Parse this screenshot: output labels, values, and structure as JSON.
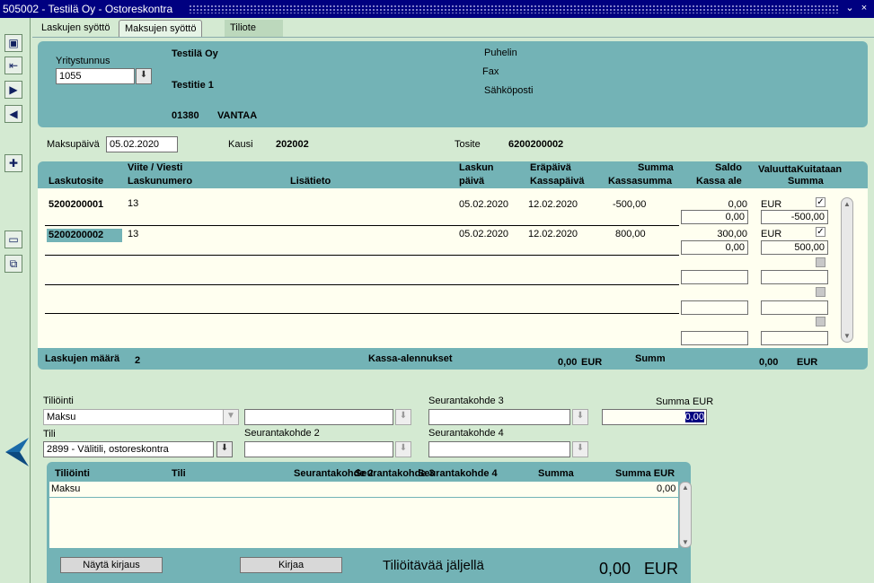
{
  "window": {
    "title": "505002 - Testilä Oy - Ostoreskontra",
    "minimize": "⌄",
    "close": "×"
  },
  "tabs": [
    {
      "label": "Laskujen syöttö"
    },
    {
      "label": "Maksujen syöttö"
    },
    {
      "label": "Tiliote"
    }
  ],
  "company": {
    "yritystunnus_label": "Yritystunnus",
    "yritystunnus_value": "1055",
    "name": "Testilä Oy",
    "address": "Testitie 1",
    "postal_code": "01380",
    "city": "VANTAA",
    "phone_label": "Puhelin",
    "fax_label": "Fax",
    "email_label": "Sähköposti"
  },
  "payment": {
    "maksupaiva_label": "Maksupäivä",
    "maksupaiva_value": "05.02.2020",
    "kausi_label": "Kausi",
    "kausi_value": "202002",
    "tosite_label": "Tosite",
    "tosite_value": "6200200002"
  },
  "grid": {
    "headers": {
      "laskutosite": "Laskutosite",
      "viite": "Viite / Viesti",
      "laskunumero": "Laskunumero",
      "lisatieto": "Lisätieto",
      "laskun": "Laskun",
      "paiva": "päivä",
      "erapaiva": "Eräpäivä",
      "kassapaiva": "Kassapäivä",
      "summa": "Summa",
      "kassasumma": "Kassasumma",
      "saldo": "Saldo",
      "kassa_ale": "Kassa ale",
      "valuutta": "Valuutta",
      "kuitataan": "Kuitataan",
      "summa2": "Summa"
    },
    "rows": [
      {
        "laskutosite": "5200200001",
        "viite": "13",
        "laskun_paiva": "05.02.2020",
        "erapaiva": "12.02.2020",
        "summa": "-500,00",
        "saldo": "0,00",
        "kassa_ale": "0,00",
        "valuutta": "EUR",
        "kuitataan": true,
        "kuitataan_summa": "-500,00"
      },
      {
        "laskutosite": "5200200002",
        "viite": "13",
        "laskun_paiva": "05.02.2020",
        "erapaiva": "12.02.2020",
        "summa": "800,00",
        "saldo": "300,00",
        "kassa_ale": "0,00",
        "valuutta": "EUR",
        "kuitataan": true,
        "kuitataan_summa": "500,00"
      }
    ],
    "footer": {
      "maara_label": "Laskujen määrä",
      "maara_value": "2",
      "kassa_label": "Kassa-alennukset",
      "kassa_value": "0,00",
      "kassa_currency": "EUR",
      "summa_label": "Summ",
      "summa_value": "0,00",
      "summa_currency": "EUR"
    }
  },
  "posting": {
    "tiliointi_label": "Tiliöinti",
    "tiliointi_value": "Maksu",
    "tili_label": "Tili",
    "tili_value": "2899 - Välitili, ostoreskontra",
    "seuranta2_label": "Seurantakohde 2",
    "seuranta3_label": "Seurantakohde 3",
    "seuranta4_label": "Seurantakohde 4",
    "summa_eur_label": "Summa EUR",
    "summa_eur_value": "0,00"
  },
  "lower": {
    "headers": {
      "tiliointi": "Tiliöinti",
      "tili": "Tili",
      "seuranta2": "Seurantakohde 2",
      "seuranta3": "Seurantakohde 3",
      "seuranta4": "Seurantakohde 4",
      "summa": "Summa",
      "summa_eur": "Summa EUR"
    },
    "rows": [
      {
        "tiliointi": "Maksu",
        "summa_eur": "0,00"
      }
    ],
    "nayta_button": "Näytä kirjaus",
    "kirjaa_button": "Kirjaa",
    "remaining_label": "Tiliöitävää jäljellä",
    "remaining_value": "0,00",
    "remaining_currency": "EUR"
  },
  "toolbar": [
    {
      "icon": "save-icon"
    },
    {
      "icon": "exit-icon"
    },
    {
      "icon": "next-icon"
    },
    {
      "icon": "previous-icon"
    },
    {
      "icon": "new-record-icon"
    },
    {
      "icon": "open-folder-icon"
    },
    {
      "icon": "copy-folder-icon"
    }
  ]
}
